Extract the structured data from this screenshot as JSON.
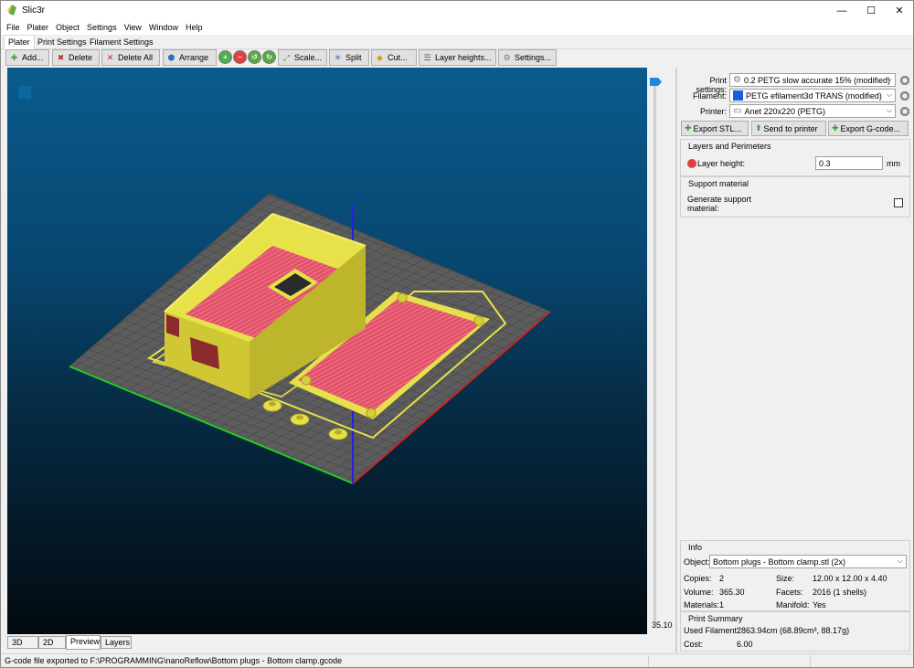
{
  "window": {
    "title": "Slic3r",
    "min_glyph": "—",
    "max_glyph": "☐",
    "close_glyph": "✕"
  },
  "menu": [
    "File",
    "Plater",
    "Object",
    "Settings",
    "View",
    "Window",
    "Help"
  ],
  "tabs": [
    "Plater",
    "Print Settings",
    "Filament Settings"
  ],
  "toolbar": {
    "add": "Add...",
    "delete": "Delete",
    "delete_all": "Delete All",
    "arrange": "Arrange",
    "scale": "Scale...",
    "split": "Split",
    "cut": "Cut...",
    "layer_heights": "Layer heights...",
    "settings": "Settings..."
  },
  "layer_slider": {
    "value": "35.10"
  },
  "view_tabs": [
    "3D",
    "2D",
    "Preview",
    "Layers"
  ],
  "presets": {
    "print_label": "Print settings:",
    "print_value": "0.2 PETG slow accurate 15% (modified)",
    "filament_label": "Filament:",
    "filament_value": "PETG efilament3d TRANS (modified)",
    "filament_color": "#1a5ee0",
    "printer_label": "Printer:",
    "printer_value": "Anet 220x220 (PETG)"
  },
  "actions": {
    "export_stl": "Export STL...",
    "send": "Send to printer",
    "export_gcode": "Export G-code..."
  },
  "layers_group": {
    "title": "Layers and Perimeters",
    "layer_height_label": "Layer height:",
    "layer_height_value": "0.3",
    "unit": "mm"
  },
  "support_group": {
    "title": "Support material",
    "generate_label_1": "Generate support",
    "generate_label_2": "material:"
  },
  "info": {
    "title": "Info",
    "object_label": "Object:",
    "object_value": "Bottom plugs - Bottom clamp.stl (2x)",
    "copies_label": "Copies:",
    "copies_value": "2",
    "size_label": "Size:",
    "size_value": "12.00 x 12.00 x 4.40",
    "volume_label": "Volume:",
    "volume_value": "365.30",
    "facets_label": "Facets:",
    "facets_value": "2016 (1 shells)",
    "materials_label": "Materials:",
    "materials_value": "1",
    "manifold_label": "Manifold:",
    "manifold_value": "Yes"
  },
  "summary": {
    "title": "Print Summary",
    "filament_label": "Used Filament:",
    "filament_value": "2863.94cm (68.89cm³, 88.17g)",
    "cost_label": "Cost:",
    "cost_value": "6.00"
  },
  "status": "G-code file exported to F:\\PROGRAMMING\\nanoReflow\\Bottom plugs - Bottom clamp.gcode"
}
